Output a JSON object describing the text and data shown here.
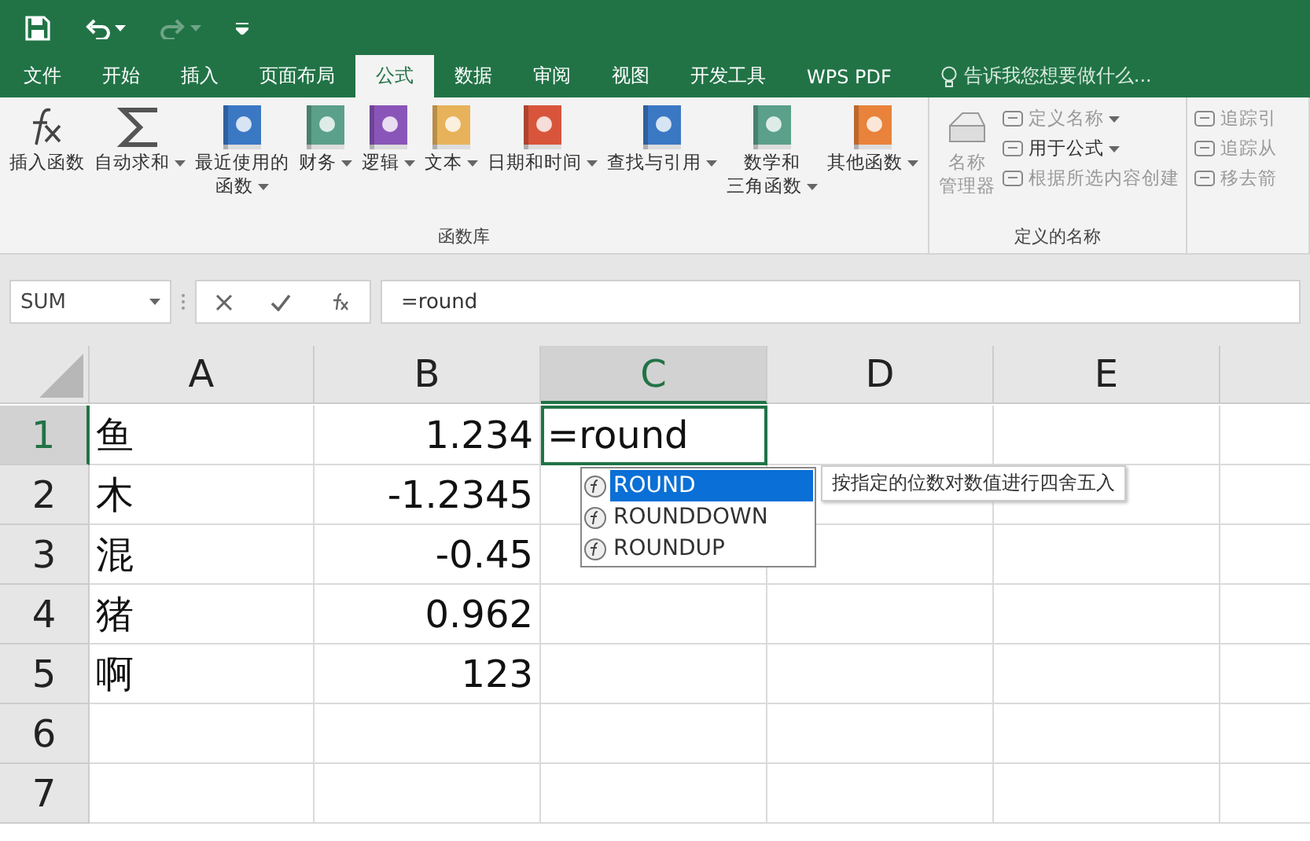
{
  "quick_access": {
    "undo_enabled": true,
    "redo_enabled": false
  },
  "tabs": [
    {
      "label": "文件",
      "selected": false
    },
    {
      "label": "开始",
      "selected": false
    },
    {
      "label": "插入",
      "selected": false
    },
    {
      "label": "页面布局",
      "selected": false
    },
    {
      "label": "公式",
      "selected": true
    },
    {
      "label": "数据",
      "selected": false
    },
    {
      "label": "审阅",
      "selected": false
    },
    {
      "label": "视图",
      "selected": false
    },
    {
      "label": "开发工具",
      "selected": false
    },
    {
      "label": "WPS PDF",
      "selected": false
    }
  ],
  "tell_me": {
    "placeholder": "告诉我您想要做什么..."
  },
  "ribbon": {
    "groups": [
      {
        "label": "函数库",
        "items": [
          {
            "kind": "large",
            "lines": [
              "插入函数"
            ],
            "dropdown": false,
            "disabled": false
          },
          {
            "kind": "large",
            "lines": [
              "自动求和"
            ],
            "dropdown": true,
            "disabled": false
          },
          {
            "kind": "large",
            "lines": [
              "最近使用的",
              "函数"
            ],
            "dropdown": true,
            "disabled": false
          },
          {
            "kind": "large",
            "lines": [
              "财务"
            ],
            "dropdown": true,
            "disabled": false
          },
          {
            "kind": "large",
            "lines": [
              "逻辑"
            ],
            "dropdown": true,
            "disabled": false
          },
          {
            "kind": "large",
            "lines": [
              "文本"
            ],
            "dropdown": true,
            "disabled": false
          },
          {
            "kind": "large",
            "lines": [
              "日期和时间"
            ],
            "dropdown": true,
            "disabled": false
          },
          {
            "kind": "large",
            "lines": [
              "查找与引用"
            ],
            "dropdown": true,
            "disabled": false
          },
          {
            "kind": "large",
            "lines": [
              "数学和",
              "三角函数"
            ],
            "dropdown": true,
            "disabled": false
          },
          {
            "kind": "large",
            "lines": [
              "其他函数"
            ],
            "dropdown": true,
            "disabled": false
          }
        ]
      },
      {
        "label": "定义的名称",
        "items": [
          {
            "kind": "large",
            "lines": [
              "名称",
              "管理器"
            ],
            "dropdown": false,
            "disabled": true
          },
          {
            "kind": "small",
            "lines": [
              "定义名称"
            ],
            "dropdown": true,
            "disabled": true
          },
          {
            "kind": "small",
            "lines": [
              "用于公式"
            ],
            "dropdown": true,
            "disabled": false
          },
          {
            "kind": "small",
            "lines": [
              "根据所选内容创建"
            ],
            "dropdown": false,
            "disabled": true
          }
        ]
      },
      {
        "items": [
          {
            "kind": "small",
            "lines": [
              "追踪引"
            ],
            "dropdown": false,
            "disabled": true
          },
          {
            "kind": "small",
            "lines": [
              "追踪从"
            ],
            "dropdown": false,
            "disabled": true
          },
          {
            "kind": "small",
            "lines": [
              "移去箭"
            ],
            "dropdown": false,
            "disabled": true
          }
        ]
      }
    ]
  },
  "formula_bar": {
    "name_box": "SUM",
    "formula": "=round"
  },
  "sheet": {
    "columns": [
      {
        "label": "A",
        "selected": false
      },
      {
        "label": "B",
        "selected": false
      },
      {
        "label": "C",
        "selected": true
      },
      {
        "label": "D",
        "selected": false
      },
      {
        "label": "E",
        "selected": false
      }
    ],
    "rows": [
      {
        "label": "1",
        "selected": true,
        "cells": [
          "鱼",
          "1.234",
          "=round",
          "",
          ""
        ]
      },
      {
        "label": "2",
        "selected": false,
        "cells": [
          "木",
          "-1.2345",
          "",
          "",
          ""
        ]
      },
      {
        "label": "3",
        "selected": false,
        "cells": [
          "混",
          "-0.45",
          "",
          "",
          ""
        ]
      },
      {
        "label": "4",
        "selected": false,
        "cells": [
          "猪",
          "0.962",
          "",
          "",
          ""
        ]
      },
      {
        "label": "5",
        "selected": false,
        "cells": [
          "啊",
          "123",
          "",
          "",
          ""
        ]
      },
      {
        "label": "6",
        "selected": false,
        "cells": [
          "",
          "",
          "",
          "",
          ""
        ]
      },
      {
        "label": "7",
        "selected": false,
        "cells": [
          "",
          "",
          "",
          "",
          ""
        ]
      }
    ]
  },
  "autocomplete": {
    "items": [
      {
        "label": "ROUND",
        "selected": true
      },
      {
        "label": "ROUNDDOWN",
        "selected": false
      },
      {
        "label": "ROUNDUP",
        "selected": false
      }
    ],
    "tooltip": "按指定的位数对数值进行四舍五入"
  }
}
